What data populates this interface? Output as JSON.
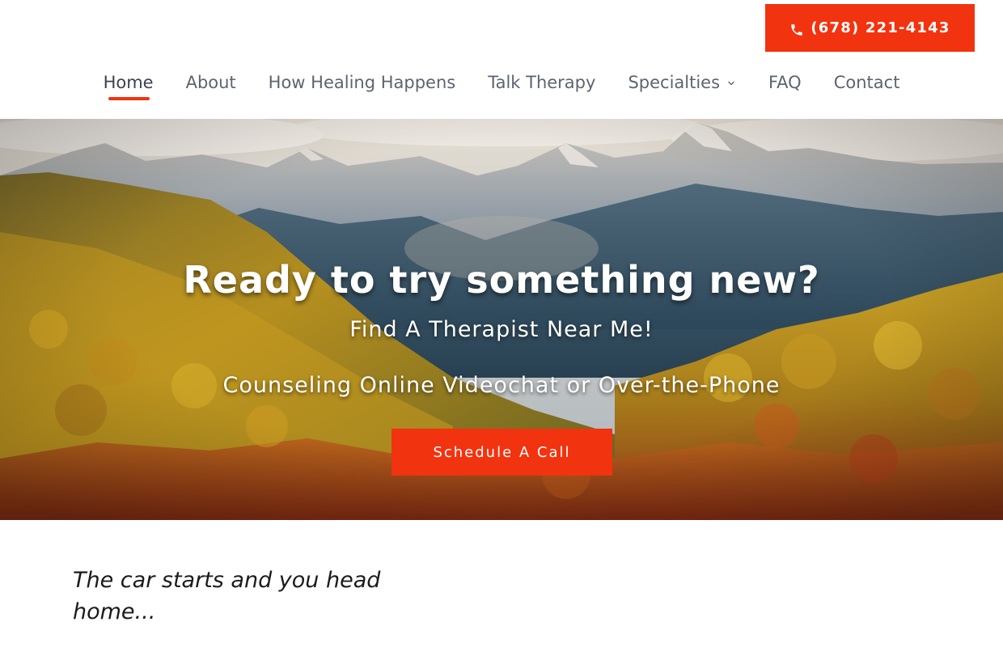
{
  "header": {
    "phone": {
      "icon": "phone-icon",
      "label": "(678) 221-4143",
      "color": "#f2330f"
    }
  },
  "nav": {
    "items": [
      {
        "label": "Home",
        "active": true
      },
      {
        "label": "About"
      },
      {
        "label": "How Healing Happens"
      },
      {
        "label": "Talk Therapy"
      },
      {
        "label": "Specialties",
        "has_dropdown": true,
        "icon": "chevron-down-icon"
      },
      {
        "label": "FAQ"
      },
      {
        "label": "Contact"
      }
    ],
    "accent_color": "#f2330f"
  },
  "hero": {
    "title": "Ready to try something new?",
    "subtitle": "Find A Therapist Near Me!",
    "tagline": "Counseling Online Videochat or Over-the-Phone",
    "cta_label": "Schedule A Call",
    "background": "autumn mountain valley photo"
  },
  "intro": {
    "text": "The car starts and you head home..."
  }
}
